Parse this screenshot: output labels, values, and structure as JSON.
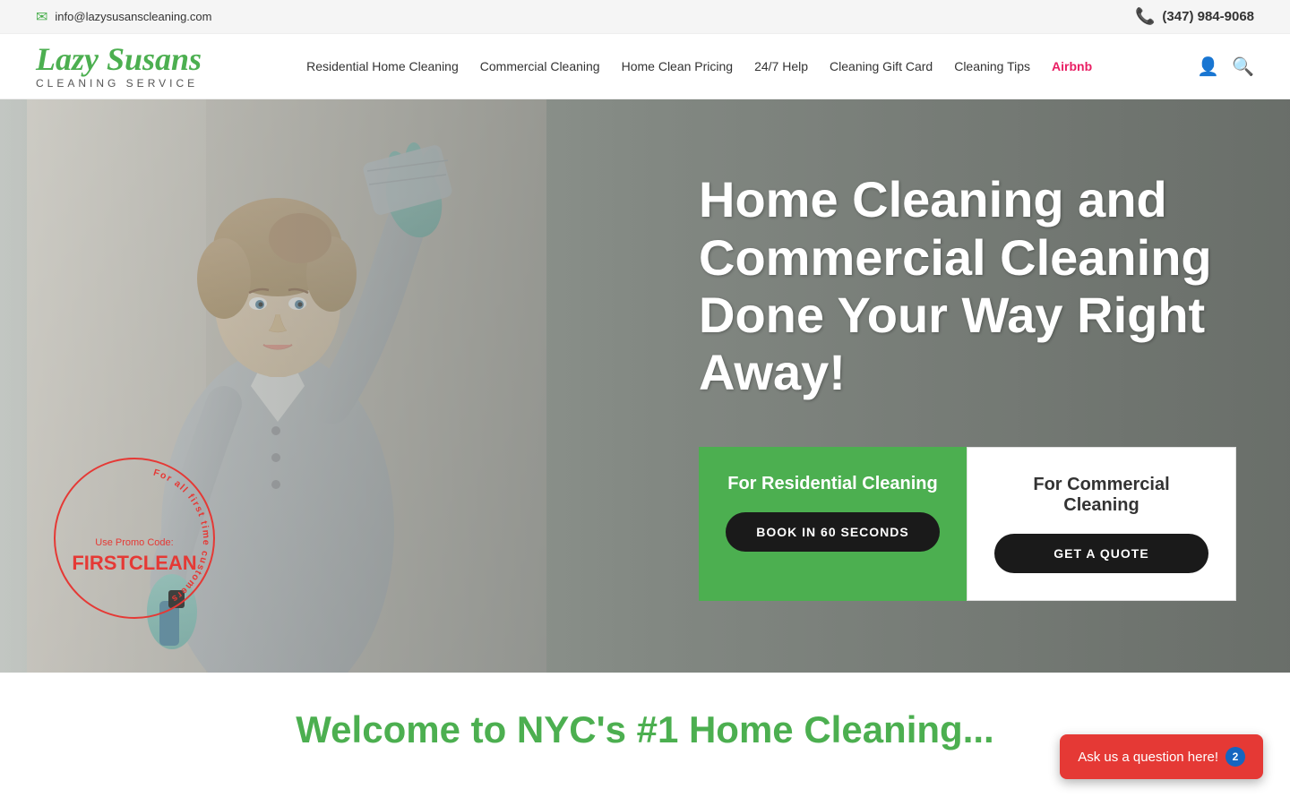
{
  "topbar": {
    "email": "info@lazysusanscleaning.com",
    "phone": "(347) 984-9068"
  },
  "logo": {
    "brand": "Lazy Susans",
    "subtitle": "CLEANING SERVICE"
  },
  "nav": {
    "items": [
      {
        "id": "residential",
        "label": "Residential Home Cleaning"
      },
      {
        "id": "commercial",
        "label": "Commercial Cleaning"
      },
      {
        "id": "pricing",
        "label": "Home Clean Pricing"
      },
      {
        "id": "help",
        "label": "24/7 Help"
      },
      {
        "id": "gift-card",
        "label": "Cleaning Gift Card"
      },
      {
        "id": "tips",
        "label": "Cleaning Tips"
      },
      {
        "id": "airbnb",
        "label": "Airbnb"
      }
    ]
  },
  "hero": {
    "headline": "Home Cleaning and Commercial Cleaning Done Your Way Right Away!",
    "promo": {
      "arc_text": "For all first time customers",
      "label": "Use Promo Code:",
      "code": "FIRSTCLEAN"
    },
    "cta_residential": {
      "label": "For Residential Cleaning",
      "button": "BOOK IN 60 SECONDS"
    },
    "cta_commercial": {
      "label": "For Commercial Cleaning",
      "button": "GET A QUOTE"
    }
  },
  "welcome": {
    "title": "Welcome to NYC's #1 Home Cleaning..."
  },
  "chat": {
    "label": "Ask us a question here!",
    "badge": "2"
  },
  "colors": {
    "green": "#4caf50",
    "red": "#e53935",
    "dark": "#1a1a1a",
    "airbnb_color": "#e91e63"
  }
}
